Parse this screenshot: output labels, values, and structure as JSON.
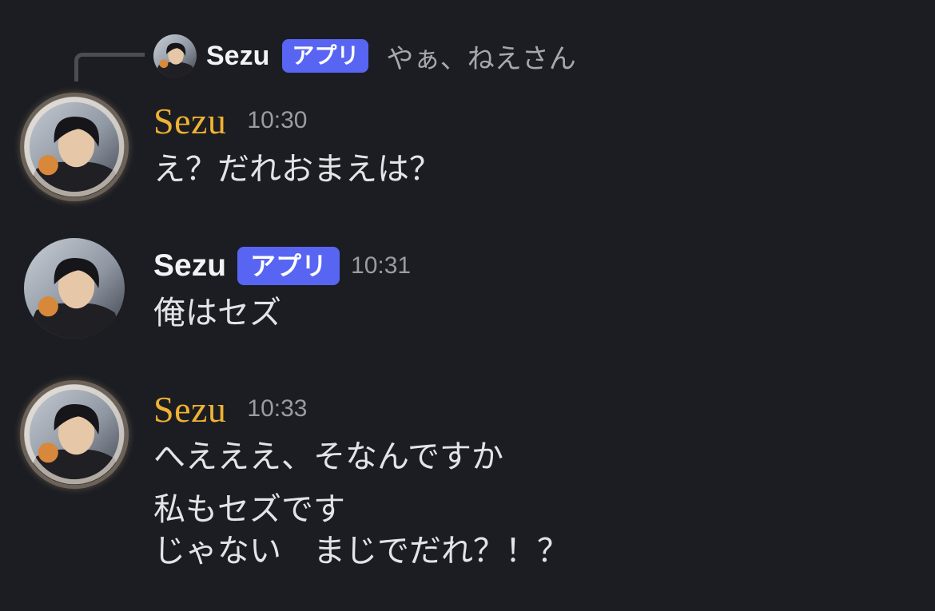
{
  "reply": {
    "author": "Sezu",
    "tag": "アプリ",
    "text": "やぁ、ねえさん"
  },
  "messages": [
    {
      "author": "Sezu",
      "time": "10:30",
      "lines": [
        "え？だれおまえは？"
      ]
    },
    {
      "author": "Sezu",
      "tag": "アプリ",
      "time": "10:31",
      "lines": [
        "俺はセズ"
      ]
    },
    {
      "author": "Sezu",
      "time": "10:33",
      "lines": [
        "へえええ、そなんですか",
        "私もセズです",
        "じゃない　まじでだれ？！？"
      ]
    }
  ],
  "colors": {
    "background": "#1c1d22",
    "gold_name": "#f0b232",
    "bot_tag": "#5865f2",
    "timestamp": "#9a9ca3",
    "message_text": "#e3e4e8"
  },
  "icons": {
    "avatar": "avatar-image",
    "avatar_decoration": "avatar-decoration-ring"
  }
}
